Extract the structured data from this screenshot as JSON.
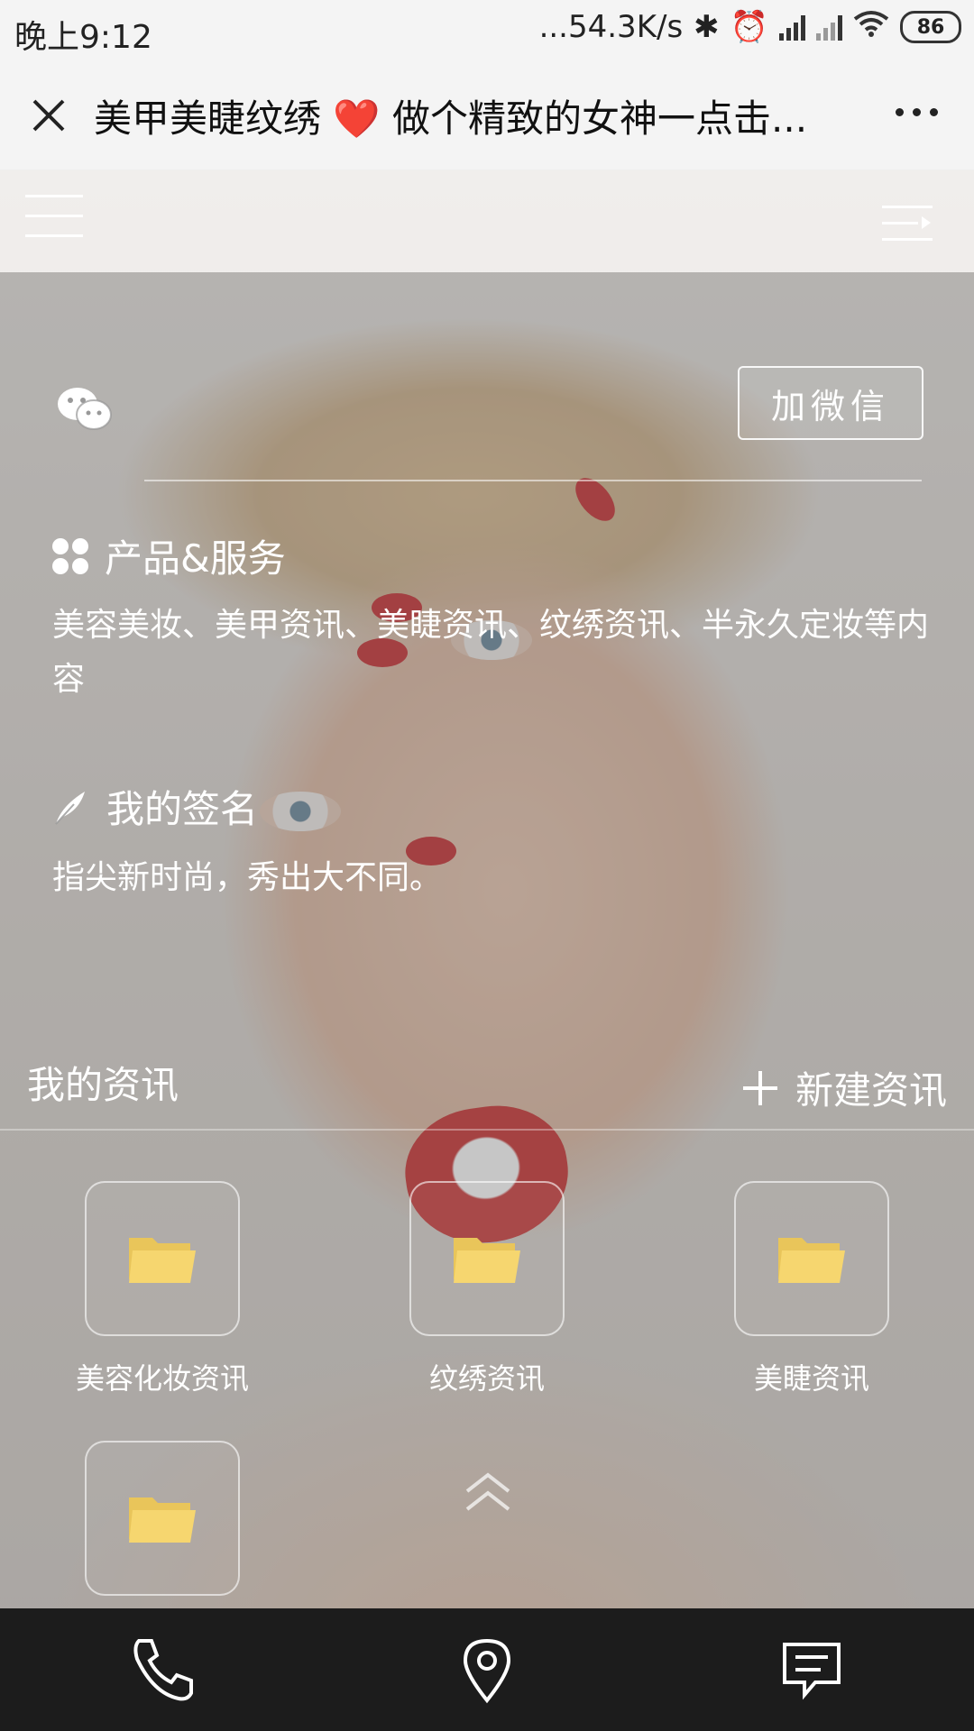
{
  "status_bar": {
    "time": "晚上9:12",
    "network_speed": "...54.3K/s",
    "battery": "86",
    "icons": [
      "bluetooth-icon",
      "alarm-icon",
      "hd-signal-icon",
      "signal-icon",
      "wifi-icon",
      "battery-icon"
    ]
  },
  "titlebar": {
    "title": "美甲美睫纹绣 ❤️ 做个精致的女神一点击...",
    "close_icon": "close-icon",
    "more_icon": "more-icon"
  },
  "profile": {
    "add_wechat_label": "加微信",
    "products_title": "产品&服务",
    "products_text": "美容美妆、美甲资讯、美睫资讯、纹绣资讯、半永久定妆等内容",
    "signature_title": "我的签名",
    "signature_text": "指尖新时尚，秀出大不同。"
  },
  "news": {
    "title": "我的资讯",
    "new_button": "新建资讯",
    "folders": [
      {
        "label": "美容化妆资讯"
      },
      {
        "label": "纹绣资讯"
      },
      {
        "label": "美睫资讯"
      },
      {
        "label": ""
      }
    ]
  },
  "bottom_bar": {
    "icons": [
      "phone-icon",
      "location-icon",
      "message-icon"
    ]
  },
  "colors": {
    "folder": "#f6d66f",
    "bottom_bar": "#1c1c1c",
    "overlay": "rgba(120,120,120,0.42)"
  }
}
